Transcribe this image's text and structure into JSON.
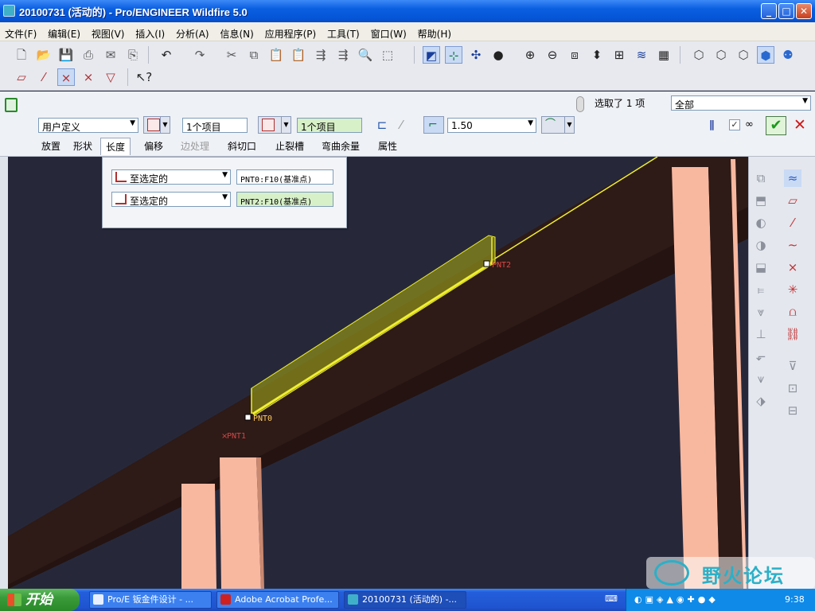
{
  "window": {
    "title": "20100731 (活动的) - Pro/ENGINEER Wildfire 5.0"
  },
  "menu": [
    "文件(F)",
    "编辑(E)",
    "视图(V)",
    "插入(I)",
    "分析(A)",
    "信息(N)",
    "应用程序(P)",
    "工具(T)",
    "窗口(W)",
    "帮助(H)"
  ],
  "dashboard": {
    "selection_count": "选取了 1 项",
    "filter_value": "全部",
    "width_type": "用户定义",
    "side1_items": "1个项目",
    "side2_items": "1个项目",
    "thickness": "1.50",
    "tabs": [
      "放置",
      "形状",
      "长度",
      "偏移",
      "边处理",
      "斜切口",
      "止裂槽",
      "弯曲余量",
      "属性"
    ]
  },
  "length_panel": {
    "row1_type": "至选定的",
    "row1_ref": "PNT0:F10(基准点)",
    "row2_type": "至选定的",
    "row2_ref": "PNT2:F10(基准点)"
  },
  "viewport": {
    "points": [
      "PNT0",
      "PNT1",
      "PNT2"
    ]
  },
  "colors": {
    "model_bg": "#26283a",
    "beam": "#2e1a16",
    "pillar": "#f8b8a0",
    "highlight": "#f0ef30"
  },
  "taskbar": {
    "start": "开始",
    "tasks": [
      "Pro/E 钣金件设计 - ...",
      "Adobe Acrobat Profe...",
      "20100731 (活动的) -..."
    ],
    "clock": "9:38"
  },
  "watermark": "野火论坛"
}
